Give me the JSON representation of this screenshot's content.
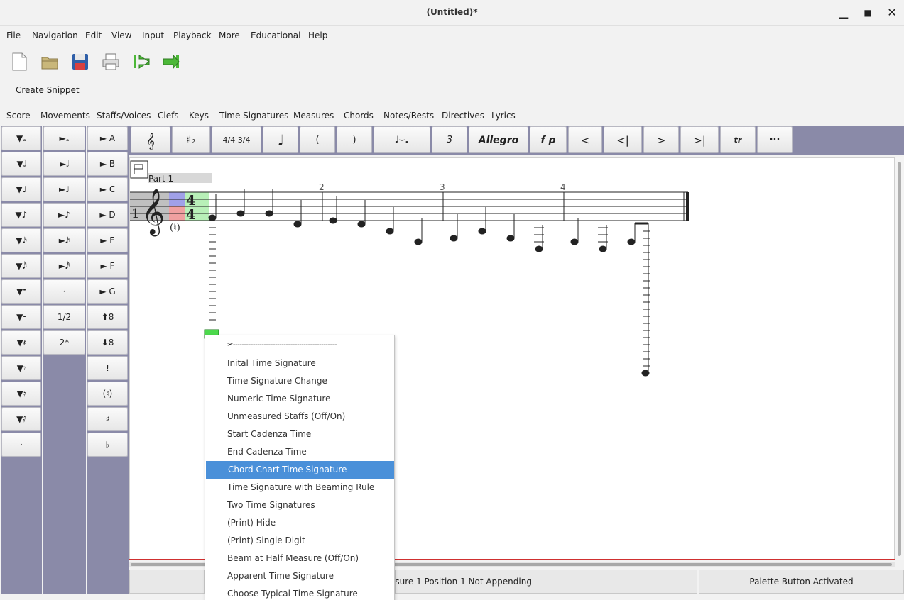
{
  "window": {
    "title": "(Untitled)*",
    "minimize": "▁",
    "maximize": "■",
    "close": "✕"
  },
  "menubar": [
    "File",
    "Navigation",
    "Edit",
    "View",
    "Input",
    "Playback",
    "More",
    "Educational",
    "Help"
  ],
  "toolbar": {
    "icons": [
      "new-file-icon",
      "open-folder-icon",
      "save-icon",
      "print-icon",
      "go-start-icon",
      "go-end-icon"
    ]
  },
  "snippet_label": "Create Snippet",
  "palette_tabs": [
    "Score",
    "Movements",
    "Staffs/Voices",
    "Clefs",
    "Keys",
    "Time Signatures",
    "Measures",
    "Chords",
    "Notes/Rests",
    "Directives",
    "Lyrics"
  ],
  "left_col1": [
    "▼𝅝",
    "▼𝅗𝅥",
    "▼♩",
    "▼♪",
    "▼𝅘𝅥𝅯",
    "▼𝅘𝅥𝅰",
    "▼𝄻",
    "▼𝄼",
    "▼𝄽",
    "▼𝄾",
    "▼𝄿",
    "▼𝅀",
    "·"
  ],
  "left_col2": [
    "►𝅝",
    "►𝅗𝅥",
    "►♩",
    "►♪",
    "►𝅘𝅥𝅯",
    "►𝅘𝅥𝅰",
    "·",
    "1/2",
    "2*"
  ],
  "left_col3": [
    "► A",
    "► B",
    "► C",
    "► D",
    "► E",
    "► F",
    "► G",
    "⬆8",
    "⬇8",
    "!",
    "(♮)",
    "♯",
    "♭"
  ],
  "top_palette": [
    "𝄞",
    "♯♭",
    "4/4 3/4",
    "𝅘𝅥",
    "(",
    ")",
    "♩⌣♩",
    "3",
    "Allegro",
    "f p",
    "<",
    "<|",
    ">",
    ">|",
    "tr",
    "···"
  ],
  "score": {
    "part_label": "Part 1",
    "staff_number": "1",
    "time_sig_top": "4",
    "time_sig_bottom": "4",
    "natural_mark": "(♮)",
    "measure_numbers": [
      "2",
      "3",
      "4"
    ]
  },
  "context_menu": {
    "tearoff": "✂-----------------------------------------------",
    "items": [
      "Inital Time Signature",
      "Time Signature Change",
      "Numeric Time Signature",
      "Unmeasured Staffs (Off/On)",
      "Start Cadenza Time",
      "End Cadenza Time",
      "Chord Chart Time Signature",
      "Time Signature with Beaming Rule",
      "Two Time Signatures",
      "(Print) Hide",
      "(Print) Single Digit",
      "Beam at Half Measure (Off/On)",
      "Apparent Time Signature",
      "Choose Typical Time Signature"
    ],
    "selected_index": 6
  },
  "status": {
    "left": "",
    "middle": "asure 1 Position 1 Not Appending",
    "right": "Palette Button Activated"
  },
  "colors": {
    "accent": "#4a90d9",
    "sidebar": "#8a8aa8",
    "cursor": "#4cd94c",
    "redline": "#d03030"
  }
}
